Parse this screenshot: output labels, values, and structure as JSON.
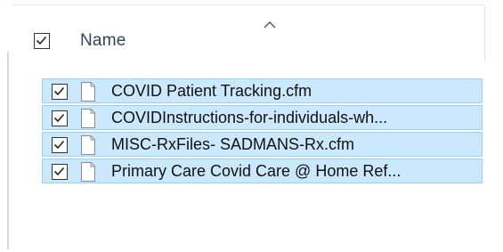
{
  "header": {
    "name_label": "Name",
    "select_all_checked": true,
    "sort_direction": "ascending"
  },
  "files": [
    {
      "name": "COVID Patient Tracking.cfm",
      "checked": true,
      "selected": true,
      "icon": "document-icon"
    },
    {
      "name": "COVIDInstructions-for-individuals-wh...",
      "checked": true,
      "selected": true,
      "icon": "document-icon"
    },
    {
      "name": "MISC-RxFiles- SADMANS-Rx.cfm",
      "checked": true,
      "selected": true,
      "icon": "document-icon"
    },
    {
      "name": "Primary Care Covid Care @ Home Ref...",
      "checked": true,
      "selected": true,
      "icon": "document-icon"
    }
  ],
  "colors": {
    "selection_fill": "#cce8ff",
    "selection_border": "#99d1ff",
    "header_text": "#33445d"
  }
}
